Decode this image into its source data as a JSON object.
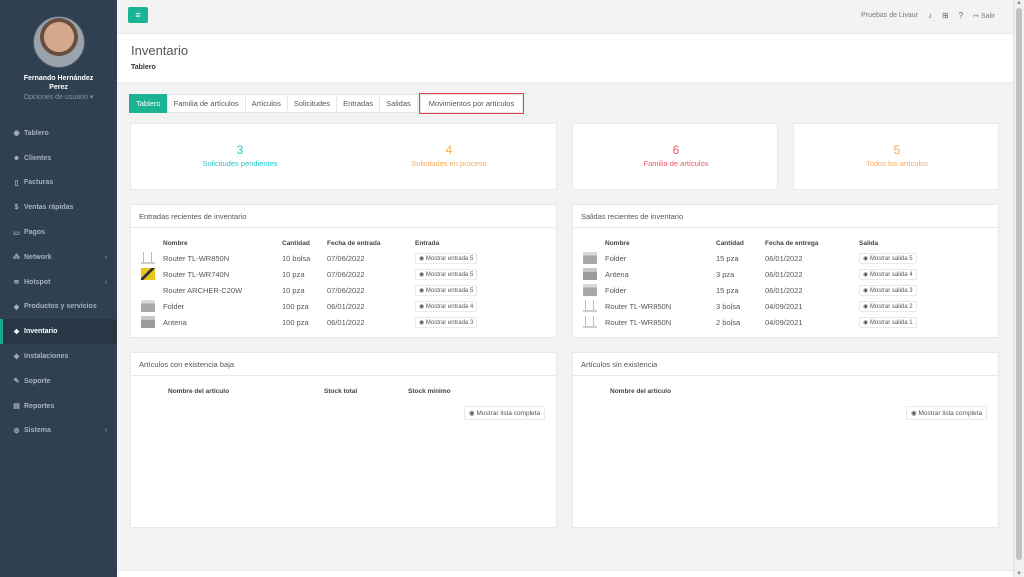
{
  "sidebar": {
    "user_name": "Fernando Hernández Perez",
    "user_options": "Opciones de usuario",
    "items": [
      {
        "label": "Tablero",
        "icon": "dashboard-icon"
      },
      {
        "label": "Clientes",
        "icon": "users-icon"
      },
      {
        "label": "Facturas",
        "icon": "file-icon"
      },
      {
        "label": "Ventas rápidas",
        "icon": "dollar-icon"
      },
      {
        "label": "Pagos",
        "icon": "money-icon"
      },
      {
        "label": "Network",
        "icon": "sitemap-icon"
      },
      {
        "label": "Hotspot",
        "icon": "wifi-icon"
      },
      {
        "label": "Productos y servicios",
        "icon": "tag-icon"
      },
      {
        "label": "Inventario",
        "icon": "cubes-icon"
      },
      {
        "label": "Instalaciones",
        "icon": "tools-icon"
      },
      {
        "label": "Soporte",
        "icon": "wrench-icon"
      },
      {
        "label": "Reportes",
        "icon": "book-icon"
      },
      {
        "label": "Sistema",
        "icon": "cogs-icon"
      }
    ]
  },
  "topbar": {
    "account": "Pruebas de Livaur",
    "logout": "Salir"
  },
  "heading": {
    "title": "Inventario",
    "breadcrumb": "Tablero"
  },
  "tabs": [
    "Tablero",
    "Familia de artículos",
    "Artículos",
    "Solicitudes",
    "Entradas",
    "Salidas",
    "Movimientos por artículos"
  ],
  "stats": {
    "solicitudes_pendientes": {
      "value": "3",
      "label": "Solicitudes pendientes",
      "color": "#23c6c8"
    },
    "solicitudes_proceso": {
      "value": "4",
      "label": "Solicitudes en proceso",
      "color": "#f8ac59"
    },
    "familia": {
      "value": "6",
      "label": "Familia de artículos",
      "color": "#ed5565"
    },
    "todos": {
      "value": "5",
      "label": "Todos los artículos",
      "color": "#f8ac59"
    }
  },
  "entradas": {
    "title": "Entradas recientes de inventario",
    "headers": [
      "Nombre",
      "Cantidad",
      "Fecha de entrada",
      "Entrada"
    ],
    "rows": [
      {
        "thumb": "router",
        "nombre": "Router TL-WR850N",
        "cantidad": "10 bolsa",
        "fecha": "07/06/2022",
        "accion": "Mostrar entrada 5"
      },
      {
        "thumb": "router2",
        "nombre": "Router TL-WR740N",
        "cantidad": "10 pza",
        "fecha": "07/06/2022",
        "accion": "Mostrar entrada 5"
      },
      {
        "thumb": "none",
        "nombre": "Router ARCHER-C20W",
        "cantidad": "10 pza",
        "fecha": "07/06/2022",
        "accion": "Mostrar entrada 5"
      },
      {
        "thumb": "folder",
        "nombre": "Folder",
        "cantidad": "100 pza",
        "fecha": "06/01/2022",
        "accion": "Mostrar entrada 4"
      },
      {
        "thumb": "antena",
        "nombre": "Antena",
        "cantidad": "100 pza",
        "fecha": "06/01/2022",
        "accion": "Mostrar entrada 3"
      }
    ]
  },
  "salidas": {
    "title": "Salidas recientes de inventario",
    "headers": [
      "Nombre",
      "Cantidad",
      "Fecha de entrega",
      "Salida"
    ],
    "rows": [
      {
        "thumb": "folder",
        "nombre": "Folder",
        "cantidad": "15 pza",
        "fecha": "06/01/2022",
        "accion": "Mostrar salida 5"
      },
      {
        "thumb": "antena",
        "nombre": "Antena",
        "cantidad": "3 pza",
        "fecha": "06/01/2022",
        "accion": "Mostrar salida 4"
      },
      {
        "thumb": "folder",
        "nombre": "Folder",
        "cantidad": "15 pza",
        "fecha": "06/01/2022",
        "accion": "Mostrar salida 3"
      },
      {
        "thumb": "router",
        "nombre": "Router TL-WR850N",
        "cantidad": "3 bolsa",
        "fecha": "04/09/2021",
        "accion": "Mostrar salida 2"
      },
      {
        "thumb": "router",
        "nombre": "Router TL-WR850N",
        "cantidad": "2 bolsa",
        "fecha": "04/09/2021",
        "accion": "Mostrar salida 1"
      }
    ]
  },
  "baja": {
    "title": "Artículos con existencia baja",
    "headers": [
      "Nombre del artículo",
      "Stock total",
      "Stock mínimo"
    ],
    "button": "Mostrar lista completa"
  },
  "sin_existencia": {
    "title": "Artículos sin existencia",
    "headers": [
      "Nombre del artículo"
    ],
    "button": "Mostrar lista completa"
  },
  "colors": {
    "accent": "#1ab394",
    "sidebar": "#2f4050",
    "highlight_border": "#e0454b"
  }
}
